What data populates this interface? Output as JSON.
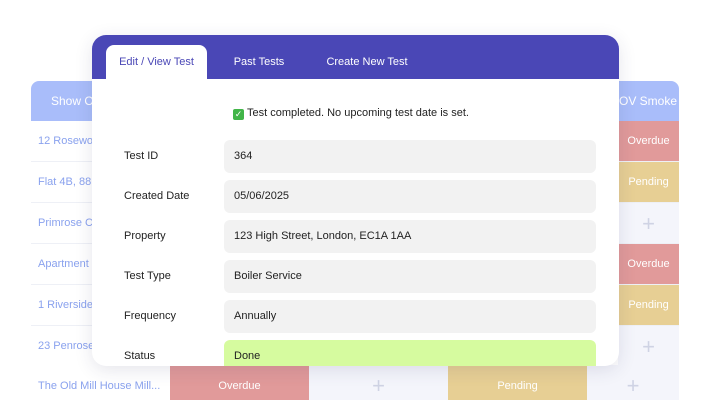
{
  "background_table": {
    "header_left": "Show Ov",
    "header_right": "OV Smoke Y",
    "rows": [
      {
        "label": "12 Rosewo",
        "status": "Overdue"
      },
      {
        "label": "Flat 4B, 88",
        "status": "Pending"
      },
      {
        "label": "Primrose C",
        "status": "+"
      },
      {
        "label": "Apartment",
        "status": "Overdue"
      },
      {
        "label": "1 Riverside",
        "status": "Pending"
      },
      {
        "label": "23 Penrose",
        "status": "+"
      }
    ],
    "bottom_row": {
      "label": "The Old Mill House Mill...",
      "cells": [
        "Overdue",
        "+",
        "Pending",
        "+"
      ]
    }
  },
  "modal": {
    "tabs": [
      {
        "label": "Edit / View Test",
        "active": true
      },
      {
        "label": "Past Tests",
        "active": false
      },
      {
        "label": "Create New Test",
        "active": false
      }
    ],
    "notice": "Test completed. No upcoming test date is set.",
    "fields": [
      {
        "label": "Test ID",
        "value": "364"
      },
      {
        "label": "Created Date",
        "value": "05/06/2025"
      },
      {
        "label": "Property",
        "value": "123 High Street, London, EC1A 1AA"
      },
      {
        "label": "Test Type",
        "value": "Boiler Service"
      },
      {
        "label": "Frequency",
        "value": "Annually"
      },
      {
        "label": "Status",
        "value": "Done"
      }
    ]
  },
  "colors": {
    "tab_bar": "#4a47b6",
    "overdue": "#e19a9a",
    "pending": "#e7cf94",
    "done": "#d6fb9f",
    "table_header": "#a9bdfa"
  }
}
